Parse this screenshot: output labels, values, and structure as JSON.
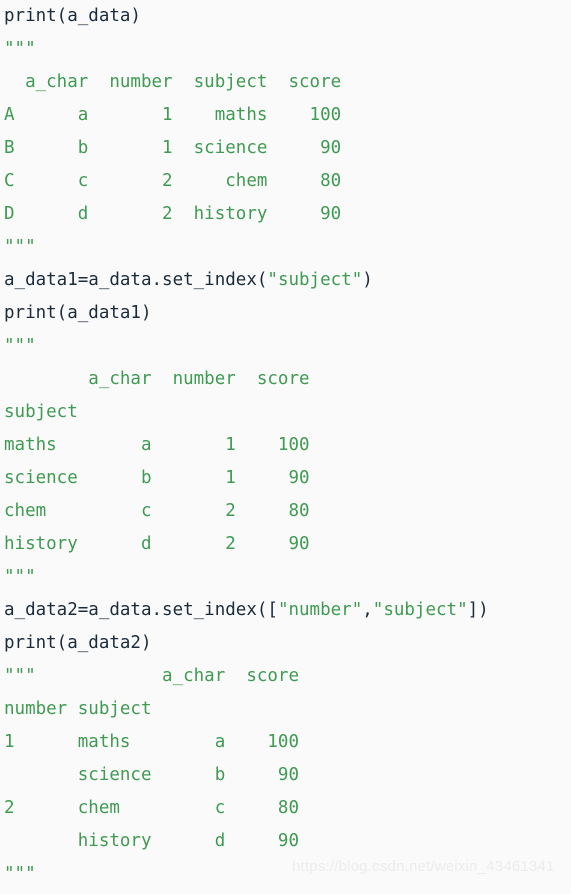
{
  "editor": {
    "background_color": "#fafafa",
    "code_color": "#1a2b3c",
    "string_color": "#3f9a52",
    "docstring_color": "#3f9a52",
    "watermark_color": "#ececec",
    "language": "python"
  },
  "watermark": {
    "text": "https://blog.csdn.net/weixin_43461341"
  },
  "lines": [
    {
      "kind": "code",
      "text": "print(a_data)"
    },
    {
      "kind": "docstring",
      "text": "\"\"\""
    },
    {
      "kind": "docstring",
      "text": "  a_char  number  subject  score"
    },
    {
      "kind": "docstring",
      "text": "A      a       1    maths    100"
    },
    {
      "kind": "docstring",
      "text": "B      b       1  science     90"
    },
    {
      "kind": "docstring",
      "text": "C      c       2     chem     80"
    },
    {
      "kind": "docstring",
      "text": "D      d       2  history     90"
    },
    {
      "kind": "docstring",
      "text": "\"\"\""
    },
    {
      "kind": "code_string",
      "prefix": "a_data1=a_data.set_index(",
      "string": "\"subject\"",
      "suffix": ")"
    },
    {
      "kind": "code",
      "text": "print(a_data1)"
    },
    {
      "kind": "docstring",
      "text": "\"\"\""
    },
    {
      "kind": "docstring",
      "text": "        a_char  number  score"
    },
    {
      "kind": "docstring",
      "text": "subject"
    },
    {
      "kind": "docstring",
      "text": "maths        a       1    100"
    },
    {
      "kind": "docstring",
      "text": "science      b       1     90"
    },
    {
      "kind": "docstring",
      "text": "chem         c       2     80"
    },
    {
      "kind": "docstring",
      "text": "history      d       2     90"
    },
    {
      "kind": "docstring",
      "text": "\"\"\""
    },
    {
      "kind": "code_string2",
      "prefix": "a_data2=a_data.set_index([",
      "string1": "\"number\"",
      "mid": ",",
      "string2": "\"subject\"",
      "suffix": "])"
    },
    {
      "kind": "code",
      "text": "print(a_data2)"
    },
    {
      "kind": "docstring",
      "text": "\"\"\"            a_char  score"
    },
    {
      "kind": "docstring",
      "text": "number subject"
    },
    {
      "kind": "docstring",
      "text": "1      maths        a    100"
    },
    {
      "kind": "docstring",
      "text": "       science      b     90"
    },
    {
      "kind": "docstring",
      "text": "2      chem         c     80"
    },
    {
      "kind": "docstring",
      "text": "       history      d     90"
    },
    {
      "kind": "docstring",
      "text": "\"\"\""
    }
  ],
  "tables": {
    "a_data": {
      "index_name": "",
      "index": [
        "A",
        "B",
        "C",
        "D"
      ],
      "columns": [
        "a_char",
        "number",
        "subject",
        "score"
      ],
      "rows": [
        [
          "a",
          "1",
          "maths",
          "100"
        ],
        [
          "b",
          "1",
          "science",
          "90"
        ],
        [
          "c",
          "2",
          "chem",
          "80"
        ],
        [
          "d",
          "2",
          "history",
          "90"
        ]
      ]
    },
    "a_data1": {
      "index_name": "subject",
      "index": [
        "maths",
        "science",
        "chem",
        "history"
      ],
      "columns": [
        "a_char",
        "number",
        "score"
      ],
      "rows": [
        [
          "a",
          "1",
          "100"
        ],
        [
          "b",
          "1",
          "90"
        ],
        [
          "c",
          "2",
          "80"
        ],
        [
          "d",
          "2",
          "90"
        ]
      ]
    },
    "a_data2": {
      "index_names": [
        "number",
        "subject"
      ],
      "index": [
        [
          "1",
          "maths"
        ],
        [
          "",
          "science"
        ],
        [
          "2",
          "chem"
        ],
        [
          "",
          "history"
        ]
      ],
      "columns": [
        "a_char",
        "score"
      ],
      "rows": [
        [
          "a",
          "100"
        ],
        [
          "b",
          "90"
        ],
        [
          "c",
          "80"
        ],
        [
          "d",
          "90"
        ]
      ]
    }
  }
}
